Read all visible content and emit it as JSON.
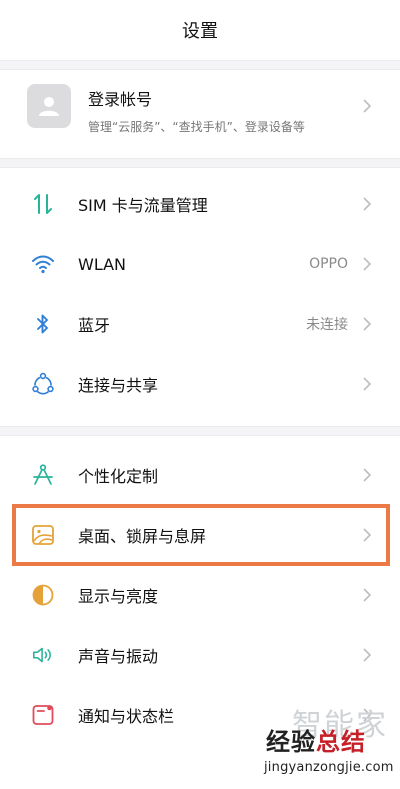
{
  "header": {
    "title": "设置"
  },
  "account": {
    "title": "登录帐号",
    "subtitle": "管理“云服务”、“查找手机”、登录设备等",
    "icon": "user-avatar-icon"
  },
  "group1": [
    {
      "label": "SIM 卡与流量管理",
      "value": "",
      "icon": "sim-data-icon"
    },
    {
      "label": "WLAN",
      "value": "OPPO",
      "icon": "wifi-icon"
    },
    {
      "label": "蓝牙",
      "value": "未连接",
      "icon": "bluetooth-icon"
    },
    {
      "label": "连接与共享",
      "value": "",
      "icon": "connection-share-icon"
    }
  ],
  "group2": [
    {
      "label": "个性化定制",
      "value": "",
      "icon": "personalization-icon"
    },
    {
      "label": "桌面、锁屏与息屏",
      "value": "",
      "icon": "wallpaper-icon"
    },
    {
      "label": "显示与亮度",
      "value": "",
      "icon": "display-brightness-icon"
    },
    {
      "label": "声音与振动",
      "value": "",
      "icon": "sound-icon"
    },
    {
      "label": "通知与状态栏",
      "value": "",
      "icon": "notification-icon"
    }
  ],
  "highlight_color": "#ec7a47",
  "watermark": {
    "top": "智能家",
    "brand_a": "经验",
    "brand_b": "总结",
    "url": "jingyanzongjie.com"
  }
}
